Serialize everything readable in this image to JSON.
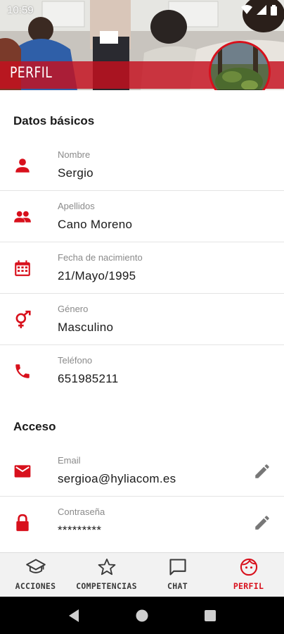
{
  "status_bar": {
    "time": "10:59"
  },
  "header": {
    "title": "PERFIL"
  },
  "sections": {
    "basic": {
      "title": "Datos básicos",
      "rows": [
        {
          "label": "Nombre",
          "value": "Sergio",
          "icon": "person-icon"
        },
        {
          "label": "Apellidos",
          "value": "Cano Moreno",
          "icon": "people-icon"
        },
        {
          "label": "Fecha de nacimiento",
          "value": "21/Mayo/1995",
          "icon": "calendar-icon"
        },
        {
          "label": "Género",
          "value": "Masculino",
          "icon": "gender-icon"
        },
        {
          "label": "Teléfono",
          "value": "651985211",
          "icon": "phone-icon"
        }
      ]
    },
    "access": {
      "title": "Acceso",
      "rows": [
        {
          "label": "Email",
          "value": "sergioa@hyliacom.es",
          "icon": "mail-icon",
          "editable": true
        },
        {
          "label": "Contraseña",
          "value": "*********",
          "icon": "lock-icon",
          "editable": true
        }
      ]
    }
  },
  "bottom_nav": {
    "items": [
      {
        "label": "ACCIONES",
        "icon": "graduation-cap-icon"
      },
      {
        "label": "COMPETENCIAS",
        "icon": "star-icon"
      },
      {
        "label": "CHAT",
        "icon": "chat-bubble-icon"
      },
      {
        "label": "PERFIL",
        "icon": "face-icon",
        "active": true
      }
    ]
  },
  "colors": {
    "accent": "#d8101c",
    "nav_bg": "#f2f2f2",
    "divider": "#e4e4e4"
  }
}
